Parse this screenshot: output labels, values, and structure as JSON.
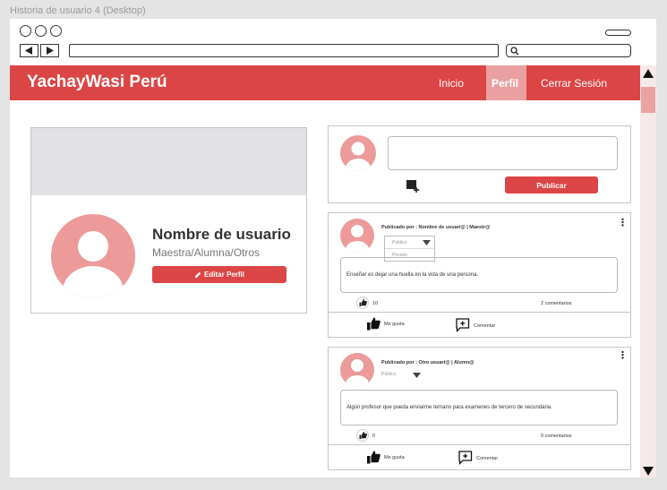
{
  "caption": "Historia de usuario 4 (Desktop)",
  "header": {
    "brand": "YachayWasi Perú",
    "nav": [
      "Inicio",
      "Perfil",
      "Cerrar Sesión"
    ],
    "active": "Perfil",
    "color": "#dc4545"
  },
  "profile": {
    "name": "Nombre de usuario",
    "role": "Maestra/Alumna/Otros",
    "edit_label": "Editar Perfil"
  },
  "composer": {
    "publish_label": "Publicar",
    "add_image_icon": "image-plus-icon"
  },
  "posts": [
    {
      "author": "Publicado por : Nombre de usuari@ | Maestr@",
      "visibility": "Público",
      "visibility_options": [
        "Público",
        "Privado"
      ],
      "text": "Enseñar es dejar una huella en la vida de una persona.",
      "likes": "10",
      "comments": "2 comentarios",
      "like_label": "Me gusta",
      "comment_label": "Comentar"
    },
    {
      "author": "Publicado por : Otro usuari@ | Alumn@",
      "visibility": "Público",
      "text": "Algún profesor que pueda enviarme temario para examenes de tercero de secundaria.",
      "likes": "0",
      "comments": "0 comentarios",
      "like_label": "Me gusta",
      "comment_label": "Comentar"
    }
  ]
}
